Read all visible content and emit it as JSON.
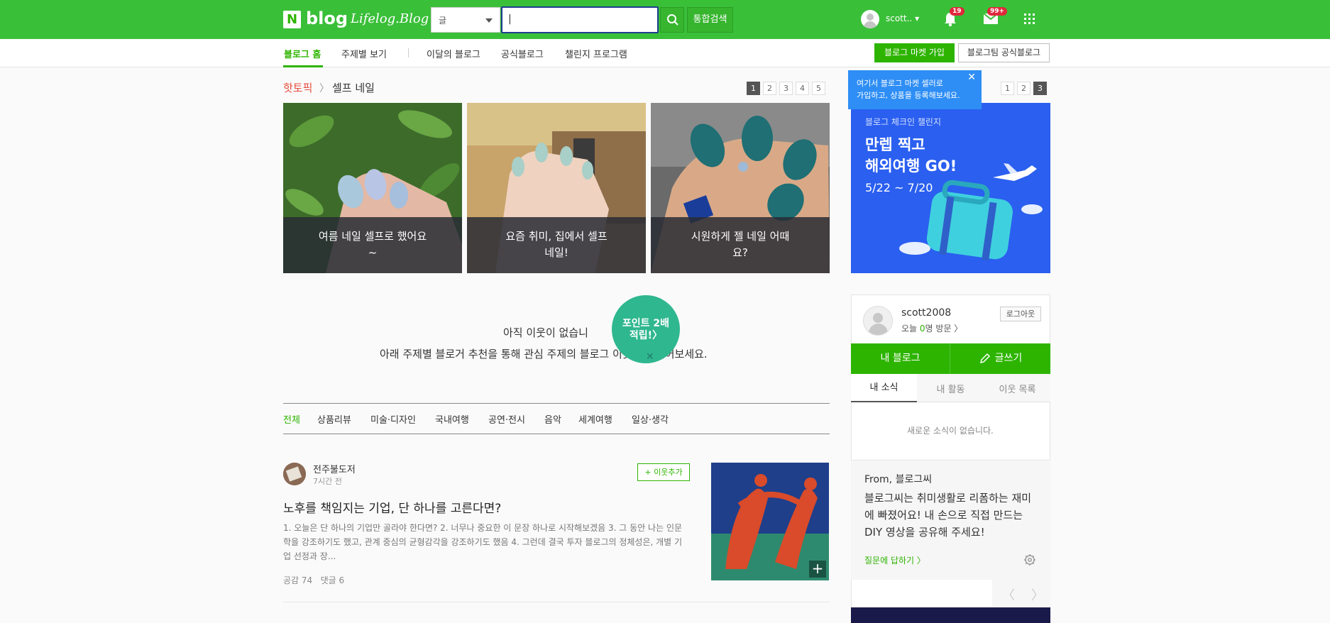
{
  "header": {
    "logo_n": "N",
    "logo_blog": "blog",
    "logo_lifelog": "Lifelog.Blog",
    "search_scope": "글",
    "search_value": "|",
    "total_search": "통합검색",
    "username": "scott..",
    "notification_count": "19",
    "mail_count": "99+"
  },
  "subnav": {
    "items": [
      "블로그 홈",
      "주제별 보기",
      "이달의 블로그",
      "공식블로그",
      "챌린지 프로그램"
    ],
    "market_join": "블로그 마켓 가입",
    "official_blog": "블로그팀 공식블로그"
  },
  "tooltip": {
    "line1": "여기서 블로그 마켓 셀러로",
    "line2": "가입하고, 상품을 등록해보세요."
  },
  "hot_topic": {
    "label": "핫토픽",
    "arrow": "〉",
    "subject": "셀프 네일",
    "pages": [
      "1",
      "2",
      "3",
      "4",
      "5"
    ],
    "cards": [
      {
        "line1": "여름 네일 셀프로 했어요",
        "line2": "~"
      },
      {
        "line1": "요즘 취미, 집에서 셀프",
        "line2": "네일!"
      },
      {
        "line1": "시원하게 젤 네일 어때",
        "line2": "요?"
      }
    ]
  },
  "promo": {
    "pages": [
      "1",
      "2",
      "3"
    ],
    "kicker": "블로그 체크인 챌린지",
    "title1": "만렙 찍고",
    "title2": "해외여행 GO!",
    "dates": "5/22 ~ 7/20"
  },
  "feed": {
    "empty_line1": "아직 이웃이 없습니",
    "empty_line2": "아래 주제별 블로거 추천을 통해 관심 주제의 블로그 이웃을 만들어보세요.",
    "point_badge_line1": "포인트 2배",
    "point_badge_line2": "적립!〉",
    "point_close": "✕",
    "categories": [
      "전체",
      "상품리뷰",
      "미술·디자인",
      "국내여행",
      "공연·전시",
      "음악",
      "세계여행",
      "일상·생각"
    ],
    "post": {
      "author": "전주불도저",
      "time": "7시간 전",
      "follow": "+ 이웃추가",
      "title": "노후를 책임지는 기업, 단 하나를 고른다면?",
      "body": "1. 오늘은 단 하나의 기업만 골라야 한다면? 2. 너무나 중요한 이 문장 하나로 시작해보겠음 3. 그 동안 나는 인문학을 강조하기도 했고, 관계 중심의 균형감각을 강조하기도 했음 4. 그런데 결국 투자 블로그의 정체성은, 개별 기업 선정과 장...",
      "likes": "공감 74",
      "comments": "댓글 6",
      "plus": "+"
    }
  },
  "sidebar": {
    "name": "scott2008",
    "visit_prefix": "오늘 ",
    "visit_count": "0",
    "visit_suffix": "명 방문 〉",
    "logout": "로그아웃",
    "my_blog": "내 블로그",
    "write": "글쓰기",
    "tabs": [
      "내 소식",
      "내 활동",
      "이웃 목록"
    ],
    "no_news": "새로운 소식이 없습니다.",
    "from_title": "From, 블로그씨",
    "from_text": "블로그씨는 취미생활로 리폼하는 재미에 빠졌어요! 내 손으로 직접 만드는 DIY 영상을 공유해 주세요!",
    "answer_link": "질문에 답하기 〉",
    "prev": "〈",
    "next": "〉"
  },
  "colors": {
    "brand_green": "#2db400",
    "topbar_green": "#3abf39",
    "promo_blue": "#2a5ff0",
    "tooltip_blue": "#2e8ef5",
    "badge_red": "#e0283b"
  }
}
